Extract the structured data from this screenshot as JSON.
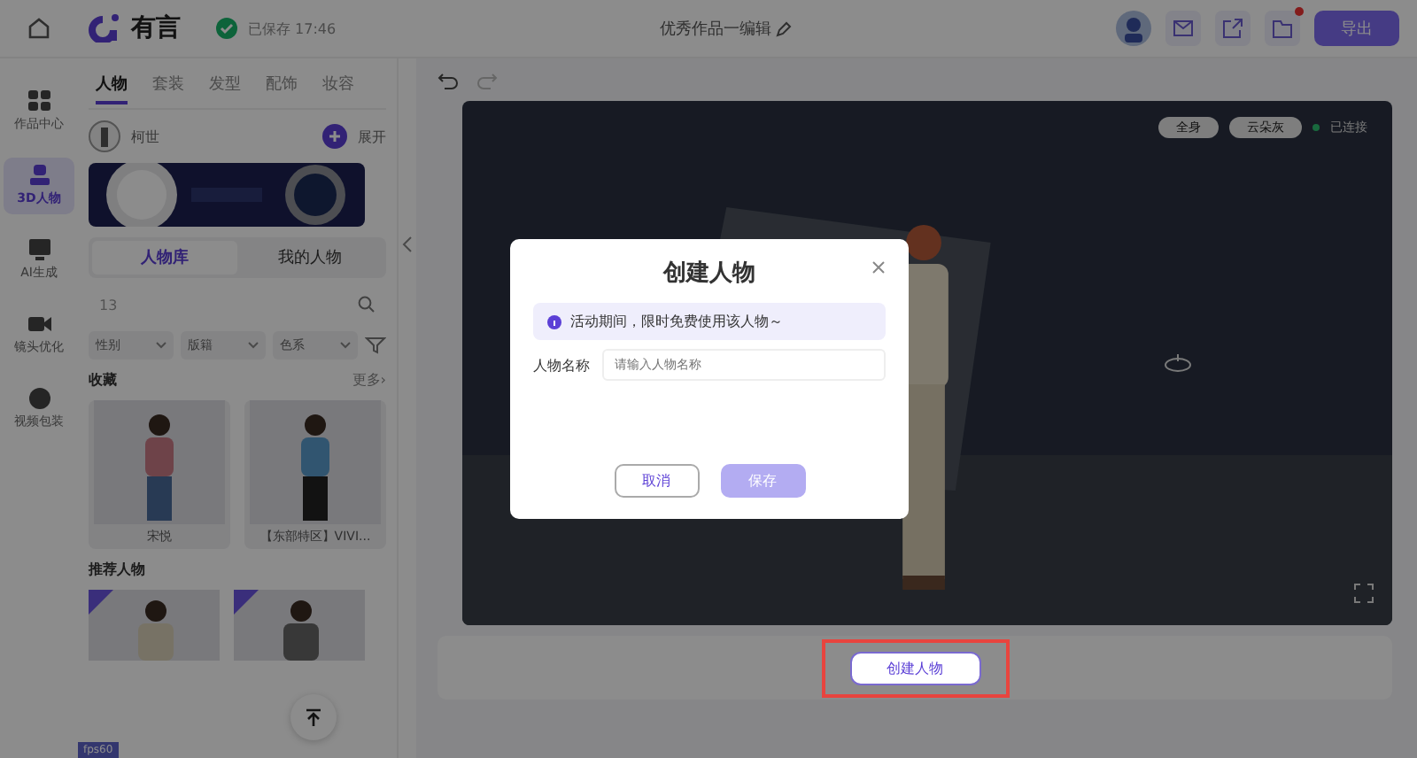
{
  "header": {
    "logo": "有言",
    "saved": "已保存 17:46",
    "title": "优秀作品一编辑",
    "export": "导出",
    "notification": true
  },
  "nav": [
    {
      "label": "作品中心",
      "selected": false
    },
    {
      "label": "3D人物",
      "selected": true
    },
    {
      "label": "AI生成",
      "selected": false
    },
    {
      "label": "镜头优化",
      "selected": false
    },
    {
      "label": "视频包装",
      "selected": false
    }
  ],
  "tabs": [
    {
      "label": "人物",
      "selected": true
    },
    {
      "label": "套装",
      "selected": false
    },
    {
      "label": "发型",
      "selected": false
    },
    {
      "label": "配饰",
      "selected": false
    },
    {
      "label": "妆容",
      "selected": false
    }
  ],
  "current": {
    "name": "柯世",
    "expand": "展开"
  },
  "library_tabs": [
    {
      "label": "人物库",
      "selected": true
    },
    {
      "label": "我的人物",
      "selected": false
    }
  ],
  "search": {
    "value": "13"
  },
  "filters": [
    "性别",
    "版籍",
    "色系"
  ],
  "favorites": {
    "title": "收藏",
    "more": "更多›",
    "items": [
      {
        "name": "宋悦"
      },
      {
        "name": "【东部特区】VIVI..."
      }
    ]
  },
  "recommended": {
    "title": "推荐人物"
  },
  "fps": "fps60",
  "preview": {
    "view": "全身",
    "background": "云朵灰",
    "status": "已连接"
  },
  "dialog": {
    "title": "创建人物",
    "notice": "活动期间，限时免费使用该人物～",
    "field_label": "人物名称",
    "placeholder": "请输入人物名称",
    "cancel": "取消",
    "save": "保存"
  },
  "bottom": {
    "create": "创建人物",
    "highlighted": true
  }
}
